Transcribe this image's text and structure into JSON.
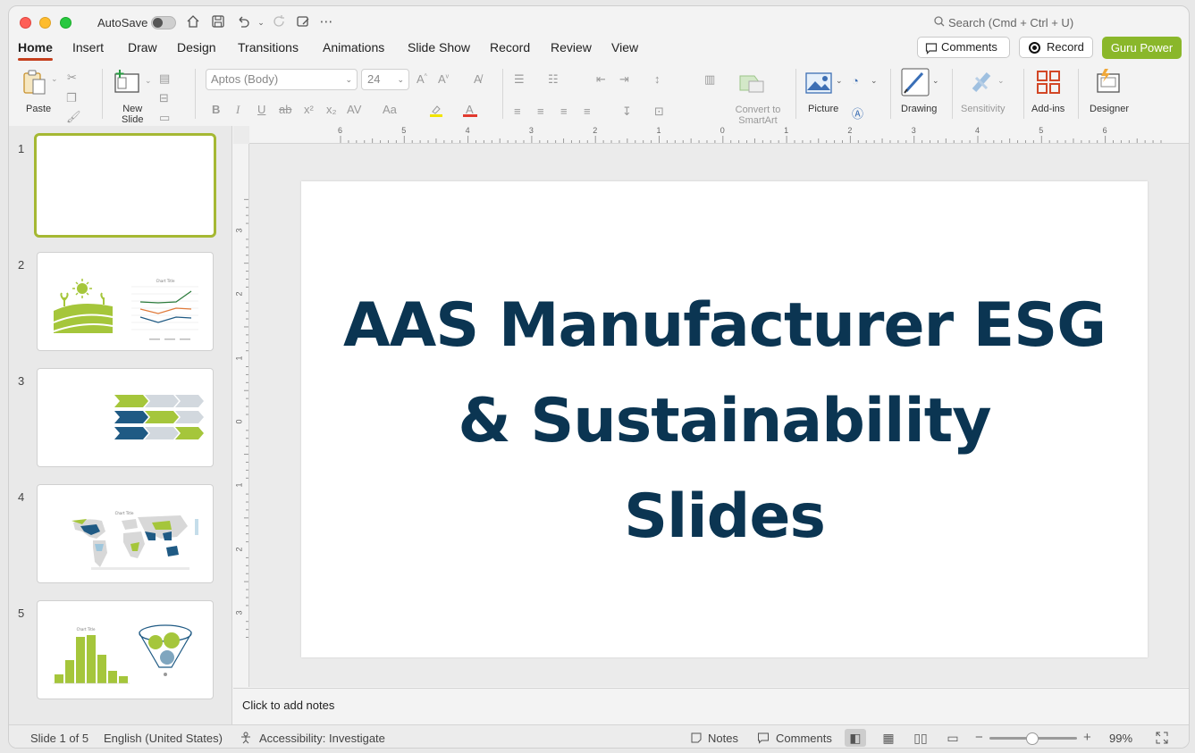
{
  "titlebar": {
    "autosave_label": "AutoSave",
    "search_placeholder": "Search (Cmd + Ctrl + U)"
  },
  "tabs": [
    {
      "label": "Home",
      "active": true
    },
    {
      "label": "Insert"
    },
    {
      "label": "Draw"
    },
    {
      "label": "Design"
    },
    {
      "label": "Transitions"
    },
    {
      "label": "Animations"
    },
    {
      "label": "Slide Show"
    },
    {
      "label": "Record"
    },
    {
      "label": "Review"
    },
    {
      "label": "View"
    }
  ],
  "header_buttons": {
    "comments": "Comments",
    "record": "Record",
    "guru": "Guru Power"
  },
  "ribbon": {
    "paste": "Paste",
    "new_slide_1": "New",
    "new_slide_2": "Slide",
    "font_name": "Aptos (Body)",
    "font_size": "24",
    "convert_1": "Convert to",
    "convert_2": "SmartArt",
    "picture": "Picture",
    "drawing": "Drawing",
    "sensitivity": "Sensitivity",
    "addins": "Add-ins",
    "designer": "Designer"
  },
  "slides": [
    {
      "number": "1"
    },
    {
      "number": "2",
      "mini_title": "Chart Title"
    },
    {
      "number": "3"
    },
    {
      "number": "4",
      "mini_title": "Chart Title"
    },
    {
      "number": "5",
      "mini_title": "Chart Title"
    }
  ],
  "slide_title": {
    "line1": "AAS Manufacturer ESG",
    "line2": "& Sustainability",
    "line3": "Slides"
  },
  "ruler": {
    "h_labels": [
      "6",
      "5",
      "4",
      "3",
      "2",
      "1",
      "0",
      "1",
      "2",
      "3",
      "4",
      "5",
      "6"
    ],
    "v_labels": [
      "3",
      "2",
      "1",
      "0",
      "1",
      "2",
      "3"
    ]
  },
  "notes_placeholder": "Click to add notes",
  "statusbar": {
    "slide_info": "Slide 1 of 5",
    "language": "English (United States)",
    "accessibility": "Accessibility: Investigate",
    "notes": "Notes",
    "comments": "Comments",
    "zoom": "99%"
  },
  "colors": {
    "title": "#0b3552",
    "accent_green": "#a5c63b",
    "accent_blue": "#1f5a84",
    "guru_button": "#8ab72a",
    "tab_underline": "#c43e1c"
  }
}
